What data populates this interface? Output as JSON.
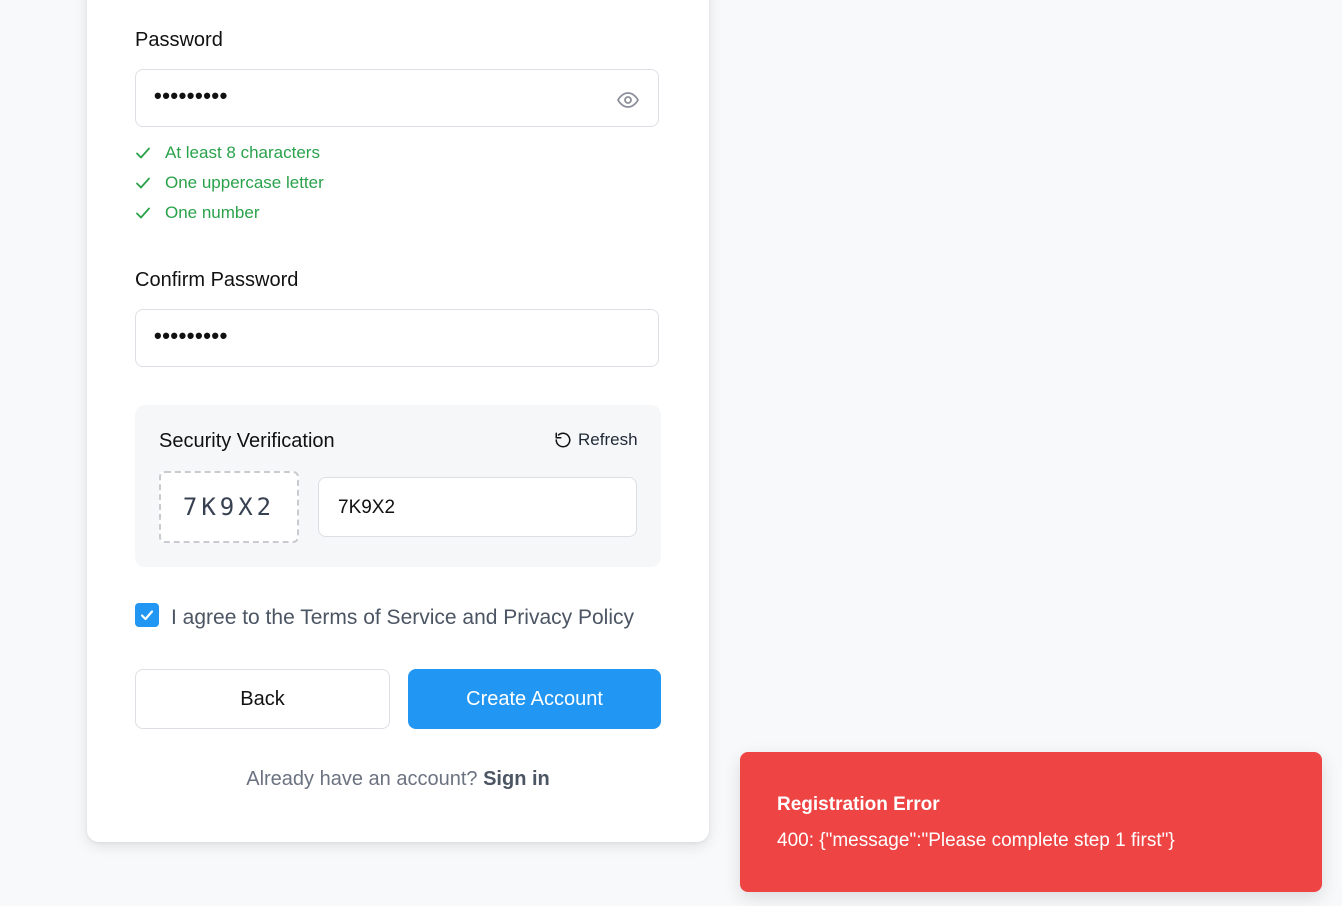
{
  "password": {
    "label": "Password",
    "value": "•••••••••",
    "requirements": [
      "At least 8 characters",
      "One uppercase letter",
      "One number"
    ]
  },
  "confirm_password": {
    "label": "Confirm Password",
    "value": "•••••••••"
  },
  "security": {
    "title": "Security Verification",
    "refresh_label": "Refresh",
    "captcha_code": "7K9X2",
    "captcha_value": "7K9X2"
  },
  "terms": {
    "checked": true,
    "label": "I agree to the Terms of Service and Privacy Policy"
  },
  "actions": {
    "back_label": "Back",
    "create_label": "Create Account"
  },
  "footer": {
    "prompt": "Already have an account?",
    "link": "Sign in"
  },
  "toast": {
    "title": "Registration Error",
    "message": "400: {\"message\":\"Please complete step 1 first\"}"
  },
  "colors": {
    "primary": "#2196f3",
    "success": "#2aa24b",
    "error": "#ef4444"
  }
}
